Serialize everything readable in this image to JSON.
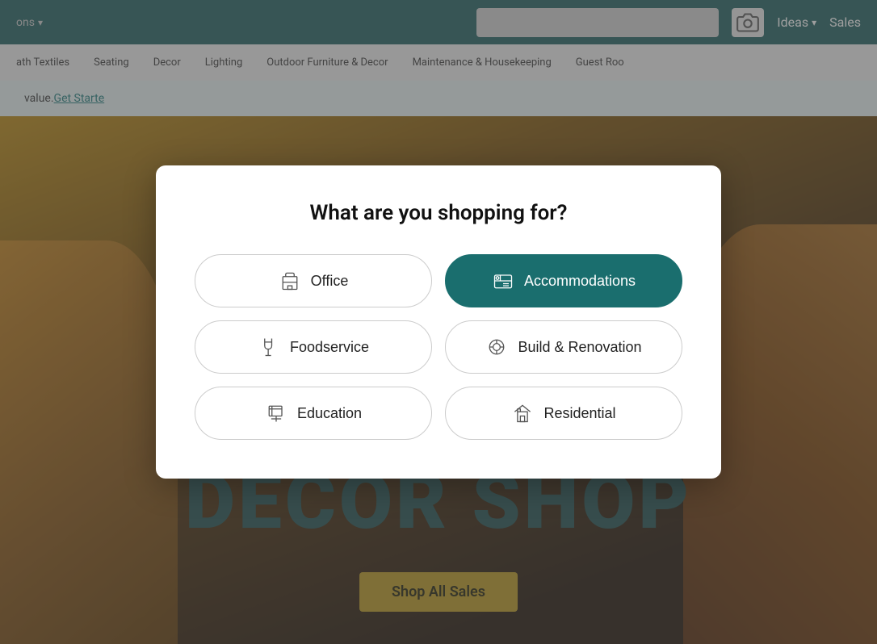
{
  "header": {
    "nav_label": "ons",
    "ideas_label": "Ideas",
    "sales_label": "Sales"
  },
  "secondary_nav": {
    "items": [
      "ath Textiles",
      "Seating",
      "Decor",
      "Lighting",
      "Outdoor Furniture & Decor",
      "Maintenance & Housekeeping",
      "Guest Roo"
    ]
  },
  "promo": {
    "text": "value. ",
    "link_text": "Get Starte"
  },
  "hero": {
    "decor_shop": "DECOR SHOP",
    "shop_btn": "Shop All Sales"
  },
  "modal": {
    "title": "What are you shopping for?",
    "options": [
      {
        "id": "office",
        "label": "Office",
        "active": false
      },
      {
        "id": "accommodations",
        "label": "Accommodations",
        "active": true
      },
      {
        "id": "foodservice",
        "label": "Foodservice",
        "active": false
      },
      {
        "id": "build-renovation",
        "label": "Build & Renovation",
        "active": false
      },
      {
        "id": "education",
        "label": "Education",
        "active": false
      },
      {
        "id": "residential",
        "label": "Residential",
        "active": false
      }
    ]
  }
}
